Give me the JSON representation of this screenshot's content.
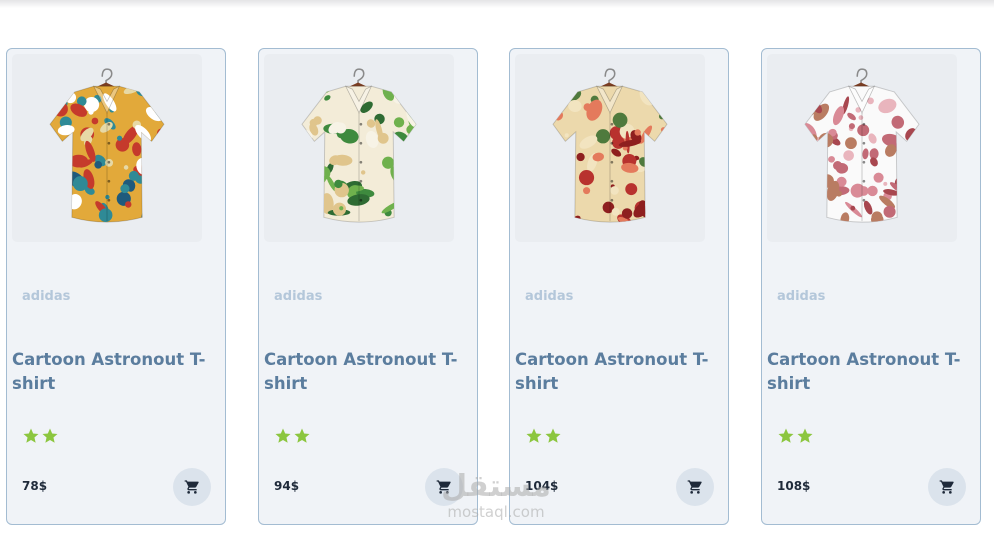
{
  "products": [
    {
      "brand": "adidas",
      "title": "Cartoon Astronout T-shirt",
      "rating": 2,
      "price": "78$",
      "image": {
        "alt": "shirt",
        "base_color": "#e2a93a",
        "pattern_colors": [
          "#2f8a96",
          "#c53a2c",
          "#ffffff",
          "#1f5a7c",
          "#e7d9a6"
        ]
      }
    },
    {
      "brand": "adidas",
      "title": "Cartoon Astronout T-shirt",
      "rating": 2,
      "price": "94$",
      "image": {
        "alt": "shirt",
        "base_color": "#f3ecd8",
        "pattern_colors": [
          "#3e8a3e",
          "#6fb14d",
          "#f7f3e6",
          "#e0c58c",
          "#2e6b33"
        ]
      }
    },
    {
      "brand": "adidas",
      "title": "Cartoon Astronout T-shirt",
      "rating": 2,
      "price": "104$",
      "image": {
        "alt": "shirt",
        "base_color": "#ecd9ac",
        "pattern_colors": [
          "#b8322e",
          "#4f7a3d",
          "#e47a5c",
          "#8e1f1f",
          "#f2e4c0"
        ]
      }
    },
    {
      "brand": "adidas",
      "title": "Cartoon Astronout T-shirt",
      "rating": 2,
      "price": "108$",
      "image": {
        "alt": "shirt",
        "base_color": "#fafafa",
        "pattern_colors": [
          "#d98a96",
          "#c26a76",
          "#a8474f",
          "#e9b5bd",
          "#b97c62"
        ]
      }
    }
  ],
  "colors": {
    "card_bg": "#f0f3f7",
    "card_border": "#a3bcd2",
    "brand_text": "#b4c7da",
    "title_text": "#5b7d9e",
    "star": "#8cc63f",
    "price_text": "#1f2a3a",
    "cart_button_bg": "#dbe3ec",
    "cart_icon": "#1f2a3a"
  },
  "icons": {
    "star": "star-icon",
    "cart": "cart-icon",
    "hanger": "hanger-icon"
  },
  "watermark": {
    "arabic": "مستقل",
    "latin": "mostaql.com"
  }
}
